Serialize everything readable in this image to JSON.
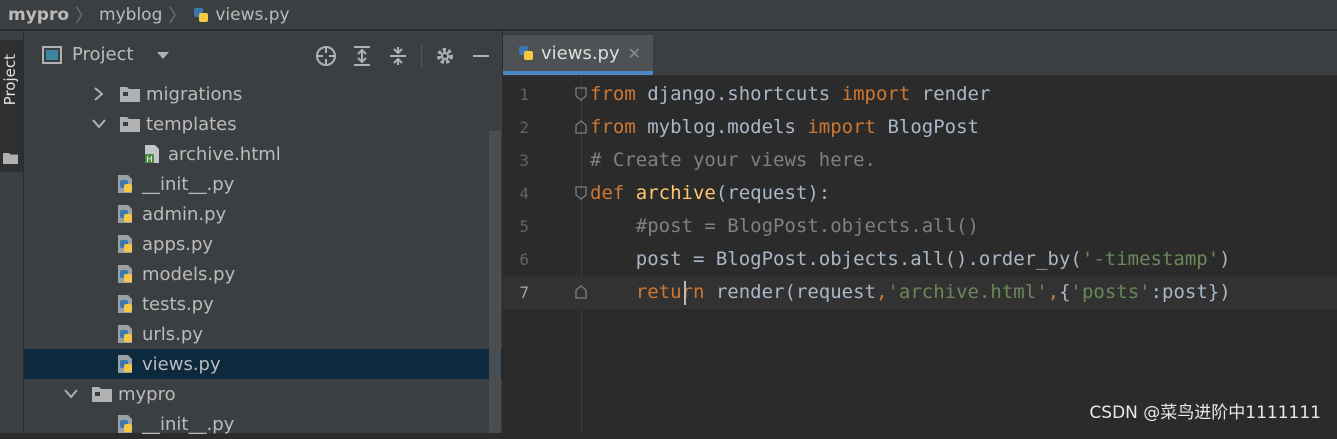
{
  "breadcrumb": {
    "items": [
      {
        "label": "mypro",
        "bold": true
      },
      {
        "label": "myblog",
        "bold": false
      },
      {
        "label": "views.py",
        "bold": false
      }
    ]
  },
  "left_tool": {
    "tab_label": "Project"
  },
  "project_panel": {
    "title": "Project",
    "tree": [
      {
        "label": "migrations",
        "type": "folder",
        "expanded": false,
        "depth": 2
      },
      {
        "label": "templates",
        "type": "folder",
        "expanded": true,
        "depth": 2
      },
      {
        "label": "archive.html",
        "type": "html",
        "depth": 3
      },
      {
        "label": "__init__.py",
        "type": "python",
        "depth": 2
      },
      {
        "label": "admin.py",
        "type": "python",
        "depth": 2
      },
      {
        "label": "apps.py",
        "type": "python",
        "depth": 2
      },
      {
        "label": "models.py",
        "type": "python",
        "depth": 2
      },
      {
        "label": "tests.py",
        "type": "python",
        "depth": 2
      },
      {
        "label": "urls.py",
        "type": "python",
        "depth": 2
      },
      {
        "label": "views.py",
        "type": "python",
        "depth": 2,
        "selected": true
      },
      {
        "label": "mypro",
        "type": "folder",
        "expanded": true,
        "depth": 1
      },
      {
        "label": "__init__.py",
        "type": "python",
        "depth": 2
      }
    ]
  },
  "editor": {
    "tab": {
      "label": "views.py",
      "close": "✕"
    },
    "lines": [
      {
        "n": "1",
        "tokens": [
          [
            "kw",
            "from "
          ],
          [
            "pl",
            "django.shortcuts "
          ],
          [
            "kw",
            "import "
          ],
          [
            "pl",
            "render"
          ]
        ]
      },
      {
        "n": "2",
        "tokens": [
          [
            "kw",
            "from "
          ],
          [
            "pl",
            "myblog.models "
          ],
          [
            "kw",
            "import "
          ],
          [
            "pl",
            "BlogPost"
          ]
        ]
      },
      {
        "n": "3",
        "tokens": [
          [
            "cm",
            "# Create your views here."
          ]
        ]
      },
      {
        "n": "4",
        "tokens": [
          [
            "kw",
            "def "
          ],
          [
            "fn",
            "archive"
          ],
          [
            "pl",
            "(request):"
          ]
        ]
      },
      {
        "n": "5",
        "tokens": [
          [
            "cm",
            "    #post = BlogPost.objects.all()"
          ]
        ]
      },
      {
        "n": "6",
        "tokens": [
          [
            "pl",
            "    post = BlogPost.objects.all().order_by("
          ],
          [
            "str",
            "'-timestamp'"
          ],
          [
            "pl",
            ")"
          ]
        ]
      },
      {
        "n": "7",
        "tokens": [
          [
            "kw",
            "    return "
          ],
          [
            "pl",
            "render(request"
          ],
          [
            "kw",
            ","
          ],
          [
            "str",
            "'archive.html'"
          ],
          [
            "kw",
            ","
          ],
          [
            "pl",
            "{"
          ],
          [
            "str",
            "'posts'"
          ],
          [
            "pl",
            ":post})"
          ]
        ],
        "current": true
      }
    ]
  },
  "watermark": "CSDN @菜鸟进阶中1111111",
  "colors": {
    "keyword": "#cc7832",
    "function": "#ffc66d",
    "string": "#6a8759",
    "comment": "#808080",
    "plain": "#a9b7c6",
    "selection": "#0d293e",
    "tab_underline": "#4a88c7"
  }
}
